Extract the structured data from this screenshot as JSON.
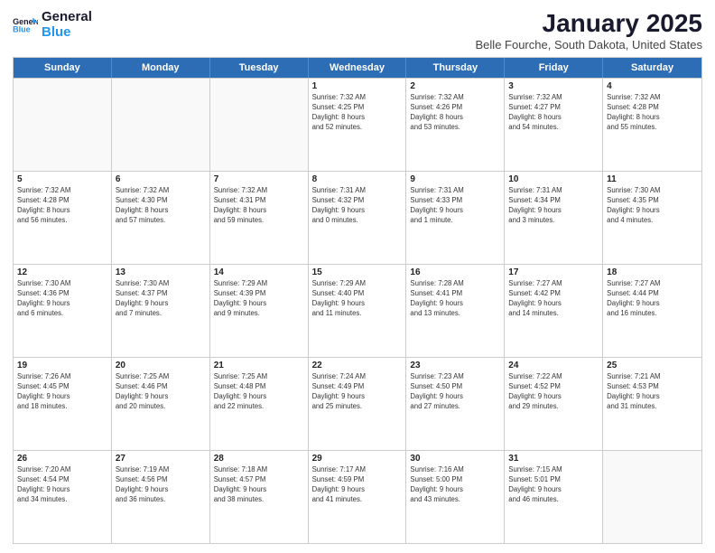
{
  "logo": {
    "line1": "General",
    "line2": "Blue"
  },
  "title": "January 2025",
  "location": "Belle Fourche, South Dakota, United States",
  "days_of_week": [
    "Sunday",
    "Monday",
    "Tuesday",
    "Wednesday",
    "Thursday",
    "Friday",
    "Saturday"
  ],
  "weeks": [
    [
      {
        "day": "",
        "lines": []
      },
      {
        "day": "",
        "lines": []
      },
      {
        "day": "",
        "lines": []
      },
      {
        "day": "1",
        "lines": [
          "Sunrise: 7:32 AM",
          "Sunset: 4:25 PM",
          "Daylight: 8 hours",
          "and 52 minutes."
        ]
      },
      {
        "day": "2",
        "lines": [
          "Sunrise: 7:32 AM",
          "Sunset: 4:26 PM",
          "Daylight: 8 hours",
          "and 53 minutes."
        ]
      },
      {
        "day": "3",
        "lines": [
          "Sunrise: 7:32 AM",
          "Sunset: 4:27 PM",
          "Daylight: 8 hours",
          "and 54 minutes."
        ]
      },
      {
        "day": "4",
        "lines": [
          "Sunrise: 7:32 AM",
          "Sunset: 4:28 PM",
          "Daylight: 8 hours",
          "and 55 minutes."
        ]
      }
    ],
    [
      {
        "day": "5",
        "lines": [
          "Sunrise: 7:32 AM",
          "Sunset: 4:28 PM",
          "Daylight: 8 hours",
          "and 56 minutes."
        ]
      },
      {
        "day": "6",
        "lines": [
          "Sunrise: 7:32 AM",
          "Sunset: 4:30 PM",
          "Daylight: 8 hours",
          "and 57 minutes."
        ]
      },
      {
        "day": "7",
        "lines": [
          "Sunrise: 7:32 AM",
          "Sunset: 4:31 PM",
          "Daylight: 8 hours",
          "and 59 minutes."
        ]
      },
      {
        "day": "8",
        "lines": [
          "Sunrise: 7:31 AM",
          "Sunset: 4:32 PM",
          "Daylight: 9 hours",
          "and 0 minutes."
        ]
      },
      {
        "day": "9",
        "lines": [
          "Sunrise: 7:31 AM",
          "Sunset: 4:33 PM",
          "Daylight: 9 hours",
          "and 1 minute."
        ]
      },
      {
        "day": "10",
        "lines": [
          "Sunrise: 7:31 AM",
          "Sunset: 4:34 PM",
          "Daylight: 9 hours",
          "and 3 minutes."
        ]
      },
      {
        "day": "11",
        "lines": [
          "Sunrise: 7:30 AM",
          "Sunset: 4:35 PM",
          "Daylight: 9 hours",
          "and 4 minutes."
        ]
      }
    ],
    [
      {
        "day": "12",
        "lines": [
          "Sunrise: 7:30 AM",
          "Sunset: 4:36 PM",
          "Daylight: 9 hours",
          "and 6 minutes."
        ]
      },
      {
        "day": "13",
        "lines": [
          "Sunrise: 7:30 AM",
          "Sunset: 4:37 PM",
          "Daylight: 9 hours",
          "and 7 minutes."
        ]
      },
      {
        "day": "14",
        "lines": [
          "Sunrise: 7:29 AM",
          "Sunset: 4:39 PM",
          "Daylight: 9 hours",
          "and 9 minutes."
        ]
      },
      {
        "day": "15",
        "lines": [
          "Sunrise: 7:29 AM",
          "Sunset: 4:40 PM",
          "Daylight: 9 hours",
          "and 11 minutes."
        ]
      },
      {
        "day": "16",
        "lines": [
          "Sunrise: 7:28 AM",
          "Sunset: 4:41 PM",
          "Daylight: 9 hours",
          "and 13 minutes."
        ]
      },
      {
        "day": "17",
        "lines": [
          "Sunrise: 7:27 AM",
          "Sunset: 4:42 PM",
          "Daylight: 9 hours",
          "and 14 minutes."
        ]
      },
      {
        "day": "18",
        "lines": [
          "Sunrise: 7:27 AM",
          "Sunset: 4:44 PM",
          "Daylight: 9 hours",
          "and 16 minutes."
        ]
      }
    ],
    [
      {
        "day": "19",
        "lines": [
          "Sunrise: 7:26 AM",
          "Sunset: 4:45 PM",
          "Daylight: 9 hours",
          "and 18 minutes."
        ]
      },
      {
        "day": "20",
        "lines": [
          "Sunrise: 7:25 AM",
          "Sunset: 4:46 PM",
          "Daylight: 9 hours",
          "and 20 minutes."
        ]
      },
      {
        "day": "21",
        "lines": [
          "Sunrise: 7:25 AM",
          "Sunset: 4:48 PM",
          "Daylight: 9 hours",
          "and 22 minutes."
        ]
      },
      {
        "day": "22",
        "lines": [
          "Sunrise: 7:24 AM",
          "Sunset: 4:49 PM",
          "Daylight: 9 hours",
          "and 25 minutes."
        ]
      },
      {
        "day": "23",
        "lines": [
          "Sunrise: 7:23 AM",
          "Sunset: 4:50 PM",
          "Daylight: 9 hours",
          "and 27 minutes."
        ]
      },
      {
        "day": "24",
        "lines": [
          "Sunrise: 7:22 AM",
          "Sunset: 4:52 PM",
          "Daylight: 9 hours",
          "and 29 minutes."
        ]
      },
      {
        "day": "25",
        "lines": [
          "Sunrise: 7:21 AM",
          "Sunset: 4:53 PM",
          "Daylight: 9 hours",
          "and 31 minutes."
        ]
      }
    ],
    [
      {
        "day": "26",
        "lines": [
          "Sunrise: 7:20 AM",
          "Sunset: 4:54 PM",
          "Daylight: 9 hours",
          "and 34 minutes."
        ]
      },
      {
        "day": "27",
        "lines": [
          "Sunrise: 7:19 AM",
          "Sunset: 4:56 PM",
          "Daylight: 9 hours",
          "and 36 minutes."
        ]
      },
      {
        "day": "28",
        "lines": [
          "Sunrise: 7:18 AM",
          "Sunset: 4:57 PM",
          "Daylight: 9 hours",
          "and 38 minutes."
        ]
      },
      {
        "day": "29",
        "lines": [
          "Sunrise: 7:17 AM",
          "Sunset: 4:59 PM",
          "Daylight: 9 hours",
          "and 41 minutes."
        ]
      },
      {
        "day": "30",
        "lines": [
          "Sunrise: 7:16 AM",
          "Sunset: 5:00 PM",
          "Daylight: 9 hours",
          "and 43 minutes."
        ]
      },
      {
        "day": "31",
        "lines": [
          "Sunrise: 7:15 AM",
          "Sunset: 5:01 PM",
          "Daylight: 9 hours",
          "and 46 minutes."
        ]
      },
      {
        "day": "",
        "lines": []
      }
    ]
  ]
}
